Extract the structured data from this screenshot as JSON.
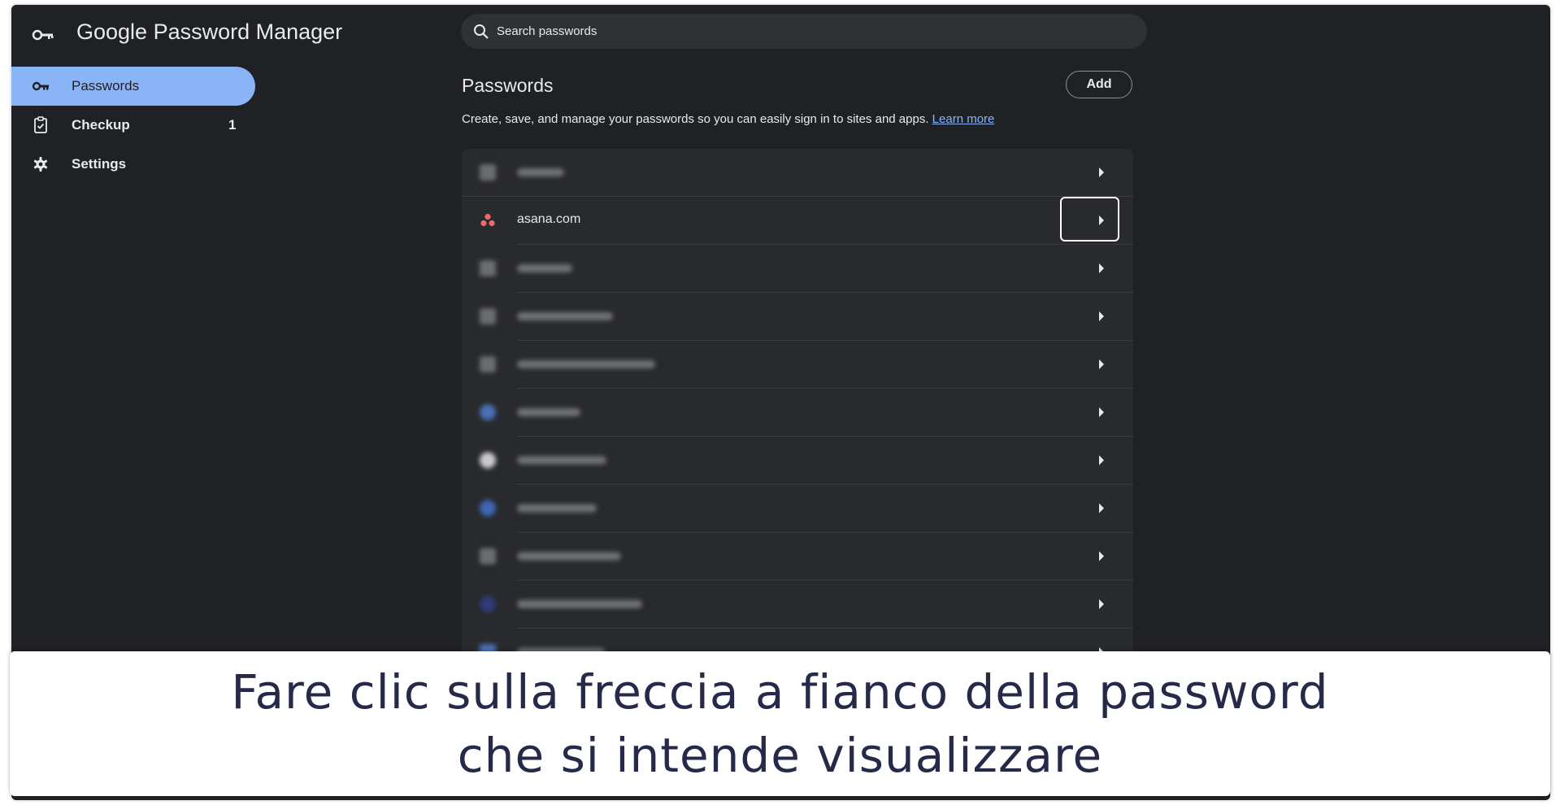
{
  "app": {
    "title": "Google Password Manager"
  },
  "sidebar": {
    "items": [
      {
        "label": "Passwords",
        "icon": "key-icon",
        "active": true
      },
      {
        "label": "Checkup",
        "icon": "clipboard-check-icon",
        "badge": "1"
      },
      {
        "label": "Settings",
        "icon": "gear-icon"
      }
    ]
  },
  "search": {
    "placeholder": "Search passwords"
  },
  "main": {
    "title": "Passwords",
    "add_label": "Add",
    "description": "Create, save, and manage your passwords so you can easily sign in to sites and apps.",
    "learn_more": "Learn more"
  },
  "password_list": {
    "visible_entry": {
      "site": "asana.com",
      "icon": "asana-icon"
    },
    "row_count": 11
  },
  "caption": {
    "line1": "Fare clic sulla freccia a fianco della password",
    "line2": "che si intende visualizzare"
  },
  "colors": {
    "background": "#202124",
    "accent": "#8ab4f8",
    "caption_text": "#252a4a",
    "asana": "#f06a6a"
  }
}
